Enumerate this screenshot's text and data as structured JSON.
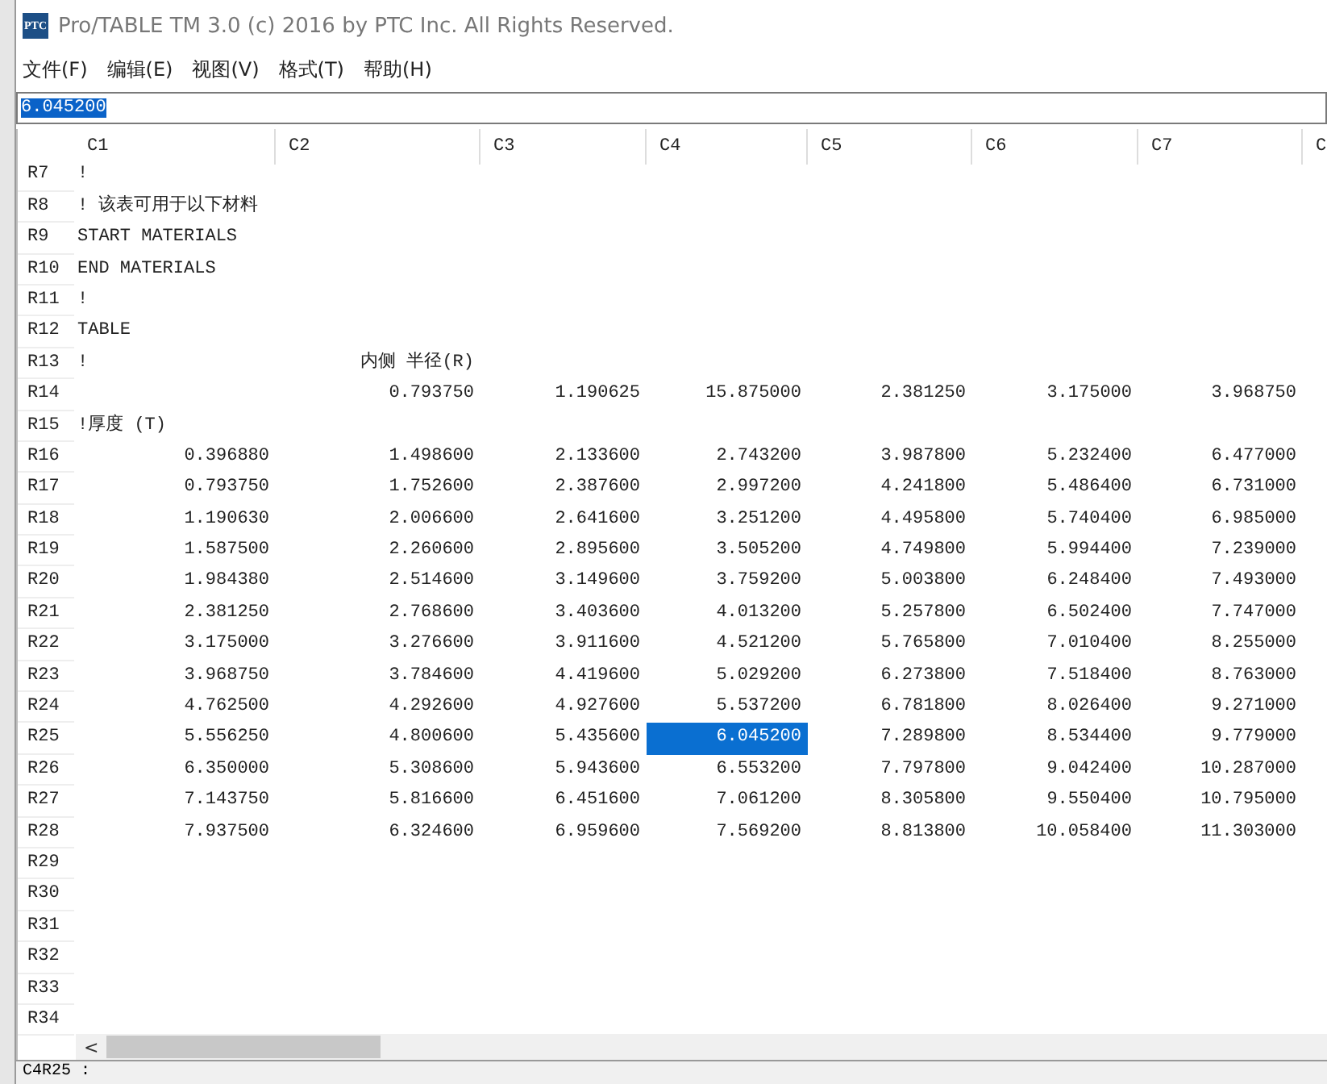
{
  "window": {
    "logo": "PTC",
    "title": "Pro/TABLE  TM  3.0  (c) 2016 by PTC Inc.  All Rights Reserved."
  },
  "menu": [
    "文件(F)",
    "编辑(E)",
    "视图(V)",
    "格式(T)",
    "帮助(H)"
  ],
  "edit_field": {
    "value": "6.045200",
    "highlighted": true
  },
  "table": {
    "columns": [
      "C1",
      "C2",
      "C3",
      "C4",
      "C5",
      "C6",
      "C7",
      "C"
    ],
    "rows": [
      {
        "label": "R7",
        "kind": "text",
        "cells": [
          {
            "text": "!",
            "selected": false
          }
        ]
      },
      {
        "label": "R8",
        "kind": "text",
        "cells": [
          {
            "text": "! 该表可用于以下材料",
            "selected": false
          }
        ]
      },
      {
        "label": "R9",
        "kind": "text",
        "cells": [
          {
            "text": "START MATERIALS",
            "selected": false
          }
        ]
      },
      {
        "label": "R10",
        "kind": "text",
        "cells": [
          {
            "text": "END MATERIALS",
            "selected": false
          }
        ]
      },
      {
        "label": "R11",
        "kind": "text",
        "cells": [
          {
            "text": "!",
            "selected": false
          }
        ]
      },
      {
        "label": "R12",
        "kind": "text",
        "cells": [
          {
            "text": "TABLE",
            "selected": false
          }
        ]
      },
      {
        "label": "R13",
        "kind": "text",
        "cells": [
          {
            "text": "!",
            "selected": false
          },
          {
            "text": "内侧  半径(R)",
            "selected": false
          }
        ]
      },
      {
        "label": "R14",
        "kind": "numbers",
        "cells": [
          null,
          {
            "text": "0.793750",
            "selected": false
          },
          {
            "text": "1.190625",
            "selected": false
          },
          {
            "text": "15.875000",
            "selected": false
          },
          {
            "text": "2.381250",
            "selected": false
          },
          {
            "text": "3.175000",
            "selected": false
          },
          {
            "text": "3.968750",
            "selected": false
          }
        ]
      },
      {
        "label": "R15",
        "kind": "text",
        "cells": [
          {
            "text": "!厚度  (T)",
            "selected": false
          }
        ]
      },
      {
        "label": "R16",
        "kind": "numbers",
        "cells": [
          {
            "text": "0.396880",
            "selected": false
          },
          {
            "text": "1.498600",
            "selected": false
          },
          {
            "text": "2.133600",
            "selected": false
          },
          {
            "text": "2.743200",
            "selected": false
          },
          {
            "text": "3.987800",
            "selected": false
          },
          {
            "text": "5.232400",
            "selected": false
          },
          {
            "text": "6.477000",
            "selected": false
          }
        ]
      },
      {
        "label": "R17",
        "kind": "numbers",
        "cells": [
          {
            "text": "0.793750",
            "selected": false
          },
          {
            "text": "1.752600",
            "selected": false
          },
          {
            "text": "2.387600",
            "selected": false
          },
          {
            "text": "2.997200",
            "selected": false
          },
          {
            "text": "4.241800",
            "selected": false
          },
          {
            "text": "5.486400",
            "selected": false
          },
          {
            "text": "6.731000",
            "selected": false
          }
        ]
      },
      {
        "label": "R18",
        "kind": "numbers",
        "cells": [
          {
            "text": "1.190630",
            "selected": false
          },
          {
            "text": "2.006600",
            "selected": false
          },
          {
            "text": "2.641600",
            "selected": false
          },
          {
            "text": "3.251200",
            "selected": false
          },
          {
            "text": "4.495800",
            "selected": false
          },
          {
            "text": "5.740400",
            "selected": false
          },
          {
            "text": "6.985000",
            "selected": false
          }
        ]
      },
      {
        "label": "R19",
        "kind": "numbers",
        "cells": [
          {
            "text": "1.587500",
            "selected": false
          },
          {
            "text": "2.260600",
            "selected": false
          },
          {
            "text": "2.895600",
            "selected": false
          },
          {
            "text": "3.505200",
            "selected": false
          },
          {
            "text": "4.749800",
            "selected": false
          },
          {
            "text": "5.994400",
            "selected": false
          },
          {
            "text": "7.239000",
            "selected": false
          }
        ]
      },
      {
        "label": "R20",
        "kind": "numbers",
        "cells": [
          {
            "text": "1.984380",
            "selected": false
          },
          {
            "text": "2.514600",
            "selected": false
          },
          {
            "text": "3.149600",
            "selected": false
          },
          {
            "text": "3.759200",
            "selected": false
          },
          {
            "text": "5.003800",
            "selected": false
          },
          {
            "text": "6.248400",
            "selected": false
          },
          {
            "text": "7.493000",
            "selected": false
          }
        ]
      },
      {
        "label": "R21",
        "kind": "numbers",
        "cells": [
          {
            "text": "2.381250",
            "selected": false
          },
          {
            "text": "2.768600",
            "selected": false
          },
          {
            "text": "3.403600",
            "selected": false
          },
          {
            "text": "4.013200",
            "selected": false
          },
          {
            "text": "5.257800",
            "selected": false
          },
          {
            "text": "6.502400",
            "selected": false
          },
          {
            "text": "7.747000",
            "selected": false
          }
        ]
      },
      {
        "label": "R22",
        "kind": "numbers",
        "cells": [
          {
            "text": "3.175000",
            "selected": false
          },
          {
            "text": "3.276600",
            "selected": false
          },
          {
            "text": "3.911600",
            "selected": false
          },
          {
            "text": "4.521200",
            "selected": false
          },
          {
            "text": "5.765800",
            "selected": false
          },
          {
            "text": "7.010400",
            "selected": false
          },
          {
            "text": "8.255000",
            "selected": false
          }
        ]
      },
      {
        "label": "R23",
        "kind": "numbers",
        "cells": [
          {
            "text": "3.968750",
            "selected": false
          },
          {
            "text": "3.784600",
            "selected": false
          },
          {
            "text": "4.419600",
            "selected": false
          },
          {
            "text": "5.029200",
            "selected": false
          },
          {
            "text": "6.273800",
            "selected": false
          },
          {
            "text": "7.518400",
            "selected": false
          },
          {
            "text": "8.763000",
            "selected": false
          }
        ]
      },
      {
        "label": "R24",
        "kind": "numbers",
        "cells": [
          {
            "text": "4.762500",
            "selected": false
          },
          {
            "text": "4.292600",
            "selected": false
          },
          {
            "text": "4.927600",
            "selected": false
          },
          {
            "text": "5.537200",
            "selected": false
          },
          {
            "text": "6.781800",
            "selected": false
          },
          {
            "text": "8.026400",
            "selected": false
          },
          {
            "text": "9.271000",
            "selected": false
          }
        ]
      },
      {
        "label": "R25",
        "kind": "numbers",
        "cells": [
          {
            "text": "5.556250",
            "selected": false
          },
          {
            "text": "4.800600",
            "selected": false
          },
          {
            "text": "5.435600",
            "selected": false
          },
          {
            "text": "6.045200",
            "selected": true
          },
          {
            "text": "7.289800",
            "selected": false
          },
          {
            "text": "8.534400",
            "selected": false
          },
          {
            "text": "9.779000",
            "selected": false
          }
        ]
      },
      {
        "label": "R26",
        "kind": "numbers",
        "cells": [
          {
            "text": "6.350000",
            "selected": false
          },
          {
            "text": "5.308600",
            "selected": false
          },
          {
            "text": "5.943600",
            "selected": false
          },
          {
            "text": "6.553200",
            "selected": false
          },
          {
            "text": "7.797800",
            "selected": false
          },
          {
            "text": "9.042400",
            "selected": false
          },
          {
            "text": "10.287000",
            "selected": false
          }
        ]
      },
      {
        "label": "R27",
        "kind": "numbers",
        "cells": [
          {
            "text": "7.143750",
            "selected": false
          },
          {
            "text": "5.816600",
            "selected": false
          },
          {
            "text": "6.451600",
            "selected": false
          },
          {
            "text": "7.061200",
            "selected": false
          },
          {
            "text": "8.305800",
            "selected": false
          },
          {
            "text": "9.550400",
            "selected": false
          },
          {
            "text": "10.795000",
            "selected": false
          }
        ]
      },
      {
        "label": "R28",
        "kind": "numbers",
        "cells": [
          {
            "text": "7.937500",
            "selected": false
          },
          {
            "text": "6.324600",
            "selected": false
          },
          {
            "text": "6.959600",
            "selected": false
          },
          {
            "text": "7.569200",
            "selected": false
          },
          {
            "text": "8.813800",
            "selected": false
          },
          {
            "text": "10.058400",
            "selected": false
          },
          {
            "text": "11.303000",
            "selected": false
          }
        ]
      },
      {
        "label": "R29",
        "cells": []
      },
      {
        "label": "R30",
        "cells": []
      },
      {
        "label": "R31",
        "cells": []
      },
      {
        "label": "R32",
        "cells": []
      },
      {
        "label": "R33",
        "cells": []
      },
      {
        "label": "R34",
        "cells": []
      }
    ]
  },
  "scrollbar": {
    "arrow": "<"
  },
  "status_bar": "C4R25 :"
}
